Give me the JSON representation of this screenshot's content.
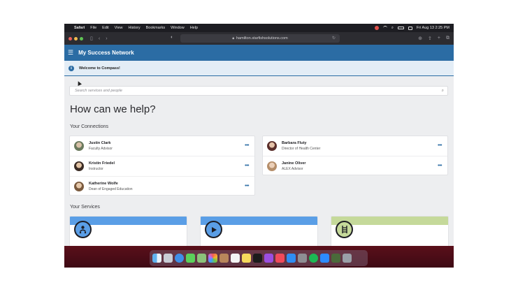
{
  "menubar": {
    "app": "Safari",
    "items": [
      "File",
      "Edit",
      "View",
      "History",
      "Bookmarks",
      "Window",
      "Help"
    ],
    "datetime": "Fri Aug 13  2:25 PM"
  },
  "browser": {
    "url": "hamilton.starfishsolutions.com"
  },
  "app": {
    "title": "My Success Network",
    "notice": "Welcome to Compass!",
    "search_placeholder": "Search services and people",
    "heading": "How can we help?",
    "connections_label": "Your Connections",
    "services_label": "Your Services"
  },
  "connections_left": [
    {
      "name": "Justin Clark",
      "role": "Faculty Advisor"
    },
    {
      "name": "Kristin Friedel",
      "role": "Instructor"
    },
    {
      "name": "Katherine Wolfe",
      "role": "Dean of Engaged Education"
    }
  ],
  "connections_right": [
    {
      "name": "Barbara Fluty",
      "role": "Director of Health Center"
    },
    {
      "name": "Janine Oliver",
      "role": "ALEX Advisor"
    }
  ],
  "services": [
    {
      "icon": "person-network-icon",
      "color": "#5a9ee6"
    },
    {
      "icon": "play-icon",
      "color": "#5a9ee6"
    },
    {
      "icon": "ladder-icon",
      "color": "#c5d99a"
    }
  ],
  "colors": {
    "header": "#2b6ca4",
    "accent": "#2b6ca4"
  }
}
